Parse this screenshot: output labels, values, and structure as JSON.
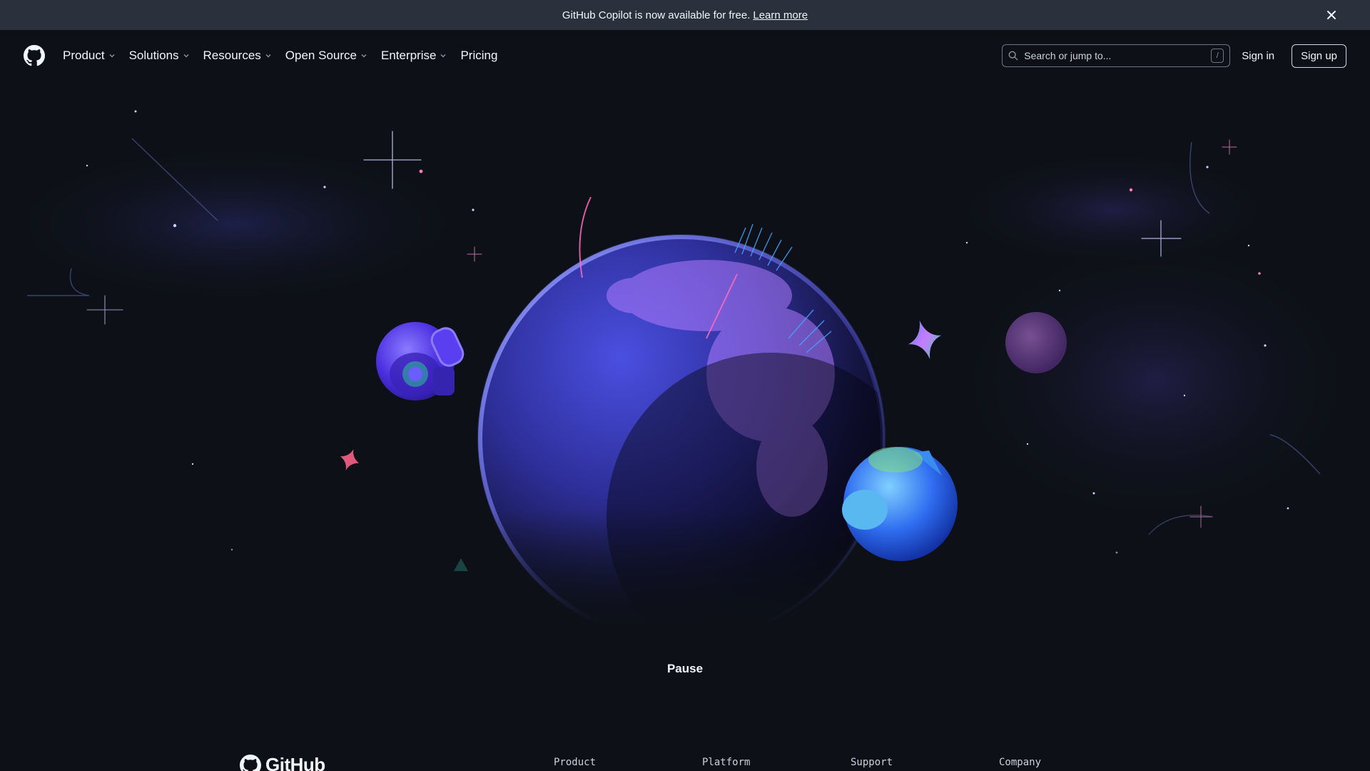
{
  "banner": {
    "message": "GitHub Copilot is now available for free.",
    "link": "Learn more"
  },
  "nav": {
    "items": [
      {
        "label": "Product",
        "dropdown": true
      },
      {
        "label": "Solutions",
        "dropdown": true
      },
      {
        "label": "Resources",
        "dropdown": true
      },
      {
        "label": "Open Source",
        "dropdown": true
      },
      {
        "label": "Enterprise",
        "dropdown": true
      },
      {
        "label": "Pricing",
        "dropdown": false
      }
    ]
  },
  "search": {
    "placeholder": "Search or jump to...",
    "shortcut": "/"
  },
  "auth": {
    "sign_in": "Sign in",
    "sign_up": "Sign up"
  },
  "hero": {
    "pause_label": "Pause"
  },
  "footer": {
    "brand": "GitHub",
    "columns": [
      "Product",
      "Platform",
      "Support",
      "Company"
    ]
  },
  "colors": {
    "background": "#0d1117",
    "banner": "#2a313c",
    "text": "#f0f6fc",
    "globe": "#3b3fd1"
  }
}
